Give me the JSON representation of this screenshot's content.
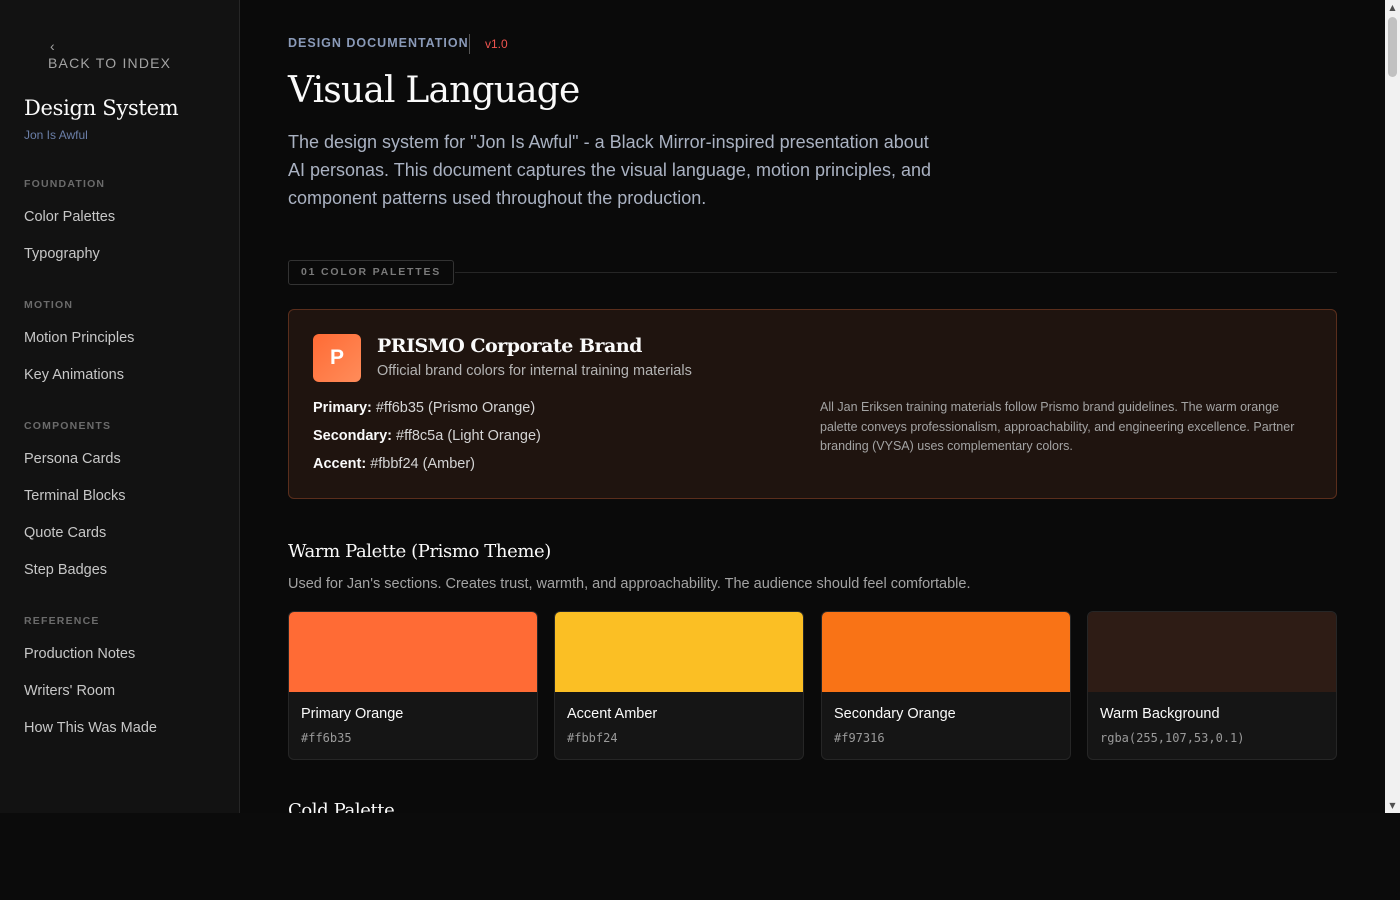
{
  "sidebar": {
    "back_chevron": "‹",
    "back_label": "BACK TO INDEX",
    "title": "Design System",
    "subtitle": "Jon Is Awful",
    "sections": [
      {
        "label": "FOUNDATION",
        "items": [
          "Color Palettes",
          "Typography"
        ]
      },
      {
        "label": "MOTION",
        "items": [
          "Motion Principles",
          "Key Animations"
        ]
      },
      {
        "label": "COMPONENTS",
        "items": [
          "Persona Cards",
          "Terminal Blocks",
          "Quote Cards",
          "Step Badges"
        ]
      },
      {
        "label": "REFERENCE",
        "items": [
          "Production Notes",
          "Writers' Room",
          "How This Was Made"
        ]
      }
    ]
  },
  "header": {
    "doc_label": "DESIGN DOCUMENTATION",
    "version": "v1.0",
    "title": "Visual Language",
    "intro": "The design system for \"Jon Is Awful\" - a Black Mirror-inspired presentation about AI personas. This document captures the visual language, motion principles, and component patterns used throughout the production."
  },
  "section": {
    "label": "01 COLOR PALETTES"
  },
  "brand": {
    "logo_letter": "P",
    "name": "PRISMO Corporate Brand",
    "description": "Official brand colors for internal training materials",
    "lines": [
      {
        "key": "Primary:",
        "value": " #ff6b35 (Prismo Orange)"
      },
      {
        "key": "Secondary:",
        "value": " #ff8c5a (Light Orange)"
      },
      {
        "key": "Accent:",
        "value": " #fbbf24 (Amber)"
      }
    ],
    "note": "All Jan Eriksen training materials follow Prismo brand guidelines. The warm orange palette conveys professionalism, approachability, and engineering excellence. Partner branding (VYSA) uses complementary colors."
  },
  "warm_palette": {
    "title": "Warm Palette (Prismo Theme)",
    "description": "Used for Jan's sections. Creates trust, warmth, and approachability. The audience should feel comfortable.",
    "swatches": [
      {
        "name": "Primary Orange",
        "code": "#ff6b35",
        "color": "#ff6b35"
      },
      {
        "name": "Accent Amber",
        "code": "#fbbf24",
        "color": "#fbbf24"
      },
      {
        "name": "Secondary Orange",
        "code": "#f97316",
        "color": "#f97316"
      },
      {
        "name": "Warm Background",
        "code": "rgba(255,107,53,0.1)",
        "color": "#2e1c15"
      }
    ]
  },
  "next_section": {
    "title": "Cold Palette"
  },
  "scrollbar": {
    "up": "▲",
    "down": "▼"
  }
}
